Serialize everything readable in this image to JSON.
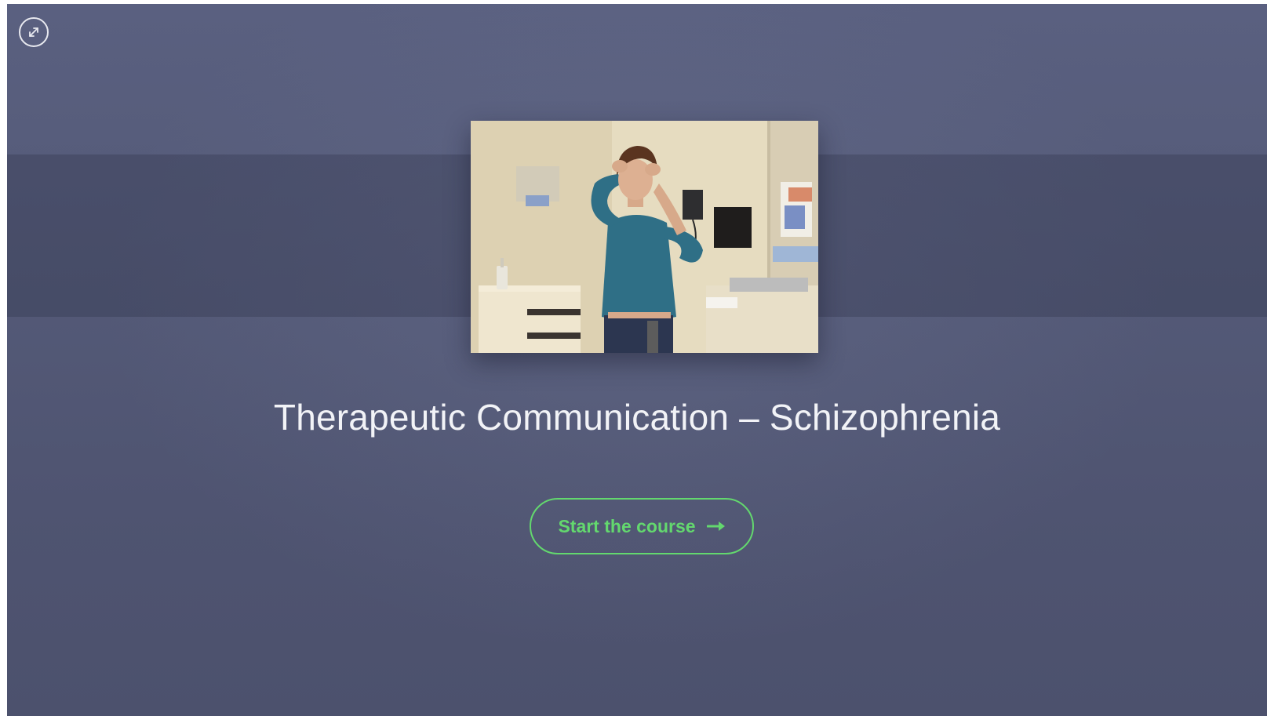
{
  "course": {
    "title": "Therapeutic Communication – Schizophrenia",
    "start_label": "Start the course"
  },
  "icons": {
    "expand": "expand-arrows-icon",
    "start_arrow": "arrow-right-icon"
  },
  "colors": {
    "background": "#555b79",
    "accent": "#63d86e",
    "title_text": "#f2f3f7"
  }
}
